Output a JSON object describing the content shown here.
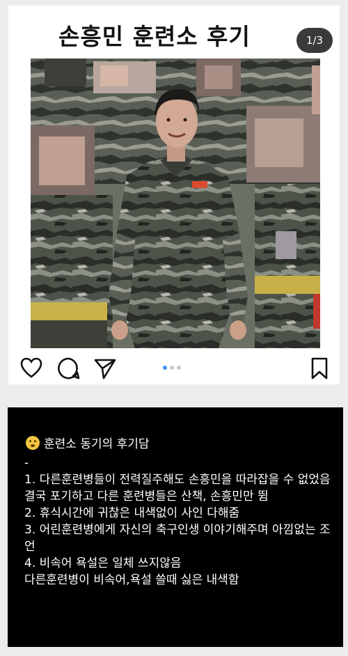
{
  "post": {
    "title": "손흥민 훈련소 후기",
    "page_indicator": "1/3",
    "colors": {
      "accent_dot": "#3897f0",
      "inactive_dot": "#c9c9c9",
      "badge": "#3a3a3a"
    },
    "icons": [
      "heart-icon",
      "comment-icon",
      "share-icon",
      "bookmark-icon"
    ]
  },
  "panel": {
    "emoji": "face-with-hand-over-mouth",
    "header": "훈련소 동기의 후기담",
    "separator": "-",
    "lines": [
      "1. 다른훈련병들이 전력질주해도 손흥민을 따라잡을 수 없었음",
      "결국 포기하고 다른 훈련병들은 산책, 손흥민만 뜀",
      "2. 휴식시간에 귀찮은 내색없이 사인 다해줌",
      "3. 어린훈련병에게 자신의 축구인생 이야기해주며 아낌없는 조언",
      "4. 비속어 욕설은 일체 쓰지않음",
      "다른훈련병이 비속어,욕설 쓸때 싫은 내색함"
    ]
  }
}
